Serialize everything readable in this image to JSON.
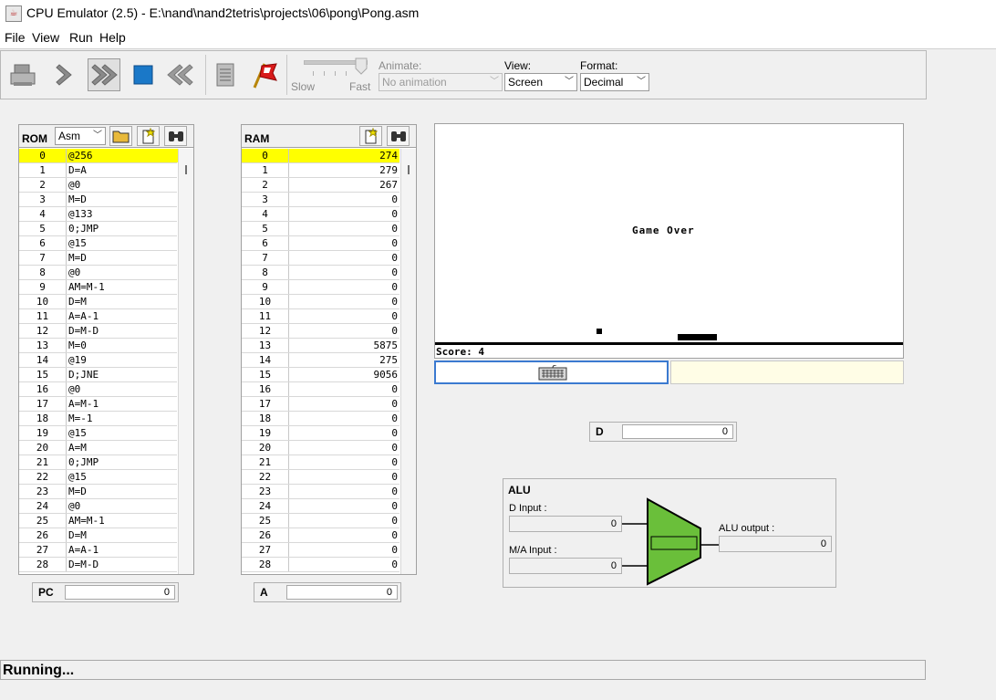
{
  "window": {
    "title": "CPU Emulator (2.5) - E:\\nand\\nand2tetris\\projects\\06\\pong\\Pong.asm"
  },
  "menu": [
    "File",
    "View",
    "Run",
    "Help"
  ],
  "toolbar": {
    "slider": {
      "slow_label": "Slow",
      "fast_label": "Fast",
      "level": 1.0
    },
    "animate": {
      "label": "Animate:",
      "value": "No animation"
    },
    "view": {
      "label": "View:",
      "value": "Screen"
    },
    "format": {
      "label": "Format:",
      "value": "Decimal"
    }
  },
  "rom": {
    "title": "ROM",
    "format": "Asm",
    "highlighted_row": 0,
    "rows": [
      [
        "0",
        "@256"
      ],
      [
        "1",
        "D=A"
      ],
      [
        "2",
        "@0"
      ],
      [
        "3",
        "M=D"
      ],
      [
        "4",
        "@133"
      ],
      [
        "5",
        "0;JMP"
      ],
      [
        "6",
        "@15"
      ],
      [
        "7",
        "M=D"
      ],
      [
        "8",
        "@0"
      ],
      [
        "9",
        "AM=M-1"
      ],
      [
        "10",
        "D=M"
      ],
      [
        "11",
        "A=A-1"
      ],
      [
        "12",
        "D=M-D"
      ],
      [
        "13",
        "M=0"
      ],
      [
        "14",
        "@19"
      ],
      [
        "15",
        "D;JNE"
      ],
      [
        "16",
        "@0"
      ],
      [
        "17",
        "A=M-1"
      ],
      [
        "18",
        "M=-1"
      ],
      [
        "19",
        "@15"
      ],
      [
        "20",
        "A=M"
      ],
      [
        "21",
        "0;JMP"
      ],
      [
        "22",
        "@15"
      ],
      [
        "23",
        "M=D"
      ],
      [
        "24",
        "@0"
      ],
      [
        "25",
        "AM=M-1"
      ],
      [
        "26",
        "D=M"
      ],
      [
        "27",
        "A=A-1"
      ],
      [
        "28",
        "D=M-D"
      ]
    ]
  },
  "ram": {
    "title": "RAM",
    "highlighted_row": 0,
    "rows": [
      [
        "0",
        "274"
      ],
      [
        "1",
        "279"
      ],
      [
        "2",
        "267"
      ],
      [
        "3",
        "0"
      ],
      [
        "4",
        "0"
      ],
      [
        "5",
        "0"
      ],
      [
        "6",
        "0"
      ],
      [
        "7",
        "0"
      ],
      [
        "8",
        "0"
      ],
      [
        "9",
        "0"
      ],
      [
        "10",
        "0"
      ],
      [
        "11",
        "0"
      ],
      [
        "12",
        "0"
      ],
      [
        "13",
        "5875"
      ],
      [
        "14",
        "275"
      ],
      [
        "15",
        "9056"
      ],
      [
        "16",
        "0"
      ],
      [
        "17",
        "0"
      ],
      [
        "18",
        "0"
      ],
      [
        "19",
        "0"
      ],
      [
        "20",
        "0"
      ],
      [
        "21",
        "0"
      ],
      [
        "22",
        "0"
      ],
      [
        "23",
        "0"
      ],
      [
        "24",
        "0"
      ],
      [
        "25",
        "0"
      ],
      [
        "26",
        "0"
      ],
      [
        "27",
        "0"
      ],
      [
        "28",
        "0"
      ]
    ]
  },
  "registers": {
    "pc": {
      "label": "PC",
      "value": "0"
    },
    "a": {
      "label": "A",
      "value": "0"
    },
    "d": {
      "label": "D",
      "value": "0"
    }
  },
  "screen": {
    "message": "Game Over",
    "score": "Score: 4"
  },
  "alu": {
    "title": "ALU",
    "d_input_label": "D Input :",
    "d_input": "0",
    "ma_input_label": "M/A Input :",
    "ma_input": "0",
    "output_label": "ALU output :",
    "output": "0",
    "color": "#6abf3a"
  },
  "status": "Running..."
}
